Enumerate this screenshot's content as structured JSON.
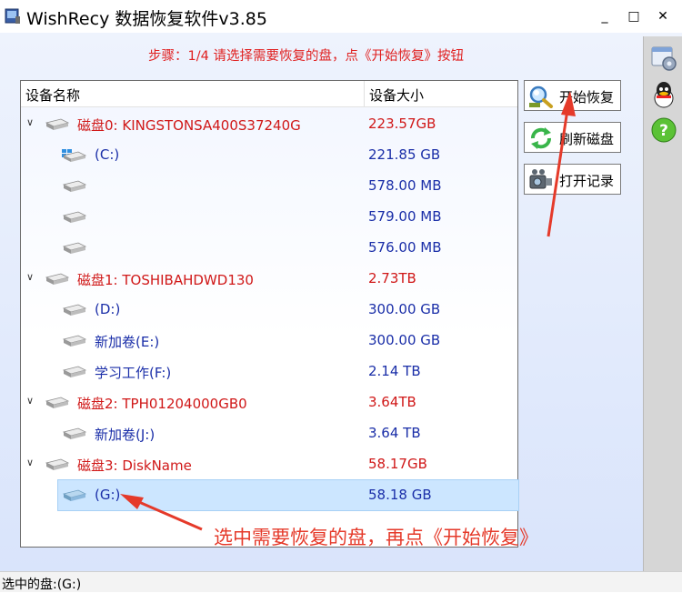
{
  "window": {
    "title": "WishRecy 数据恢复软件v3.85",
    "minimize_glyph": "_",
    "maximize_glyph": "□",
    "close_glyph": "✕"
  },
  "step_text": "步骤：1/4 请选择需要恢复的盘，点《开始恢复》按钮",
  "table": {
    "col_name": "设备名称",
    "col_size": "设备大小",
    "rows": [
      {
        "type": "disk",
        "icon": "hard-disk-icon",
        "label": "磁盘0: KINGSTONSA400S37240G",
        "size": "223.57GB"
      },
      {
        "type": "partition",
        "icon": "windows-drive-icon",
        "label": "(C:)",
        "size": "221.85 GB"
      },
      {
        "type": "partition",
        "icon": "drive-icon",
        "label": "",
        "size": "578.00 MB"
      },
      {
        "type": "partition",
        "icon": "drive-icon",
        "label": "",
        "size": "579.00 MB"
      },
      {
        "type": "partition",
        "icon": "drive-icon",
        "label": "",
        "size": "576.00 MB"
      },
      {
        "type": "disk",
        "icon": "hard-disk-icon",
        "label": "磁盘1: TOSHIBAHDWD130",
        "size": "2.73TB"
      },
      {
        "type": "partition",
        "icon": "drive-icon",
        "label": "(D:)",
        "size": "300.00 GB"
      },
      {
        "type": "partition",
        "icon": "drive-icon",
        "label": "新加卷(E:)",
        "size": "300.00 GB"
      },
      {
        "type": "partition",
        "icon": "drive-icon",
        "label": "学习工作(F:)",
        "size": "2.14 TB"
      },
      {
        "type": "disk",
        "icon": "hard-disk-icon",
        "label": "磁盘2: TPH01204000GB0",
        "size": "3.64TB"
      },
      {
        "type": "partition",
        "icon": "drive-icon",
        "label": "新加卷(J:)",
        "size": "3.64 TB"
      },
      {
        "type": "disk",
        "icon": "hard-disk-icon",
        "label": "磁盘3: DiskName",
        "size": "58.17GB"
      },
      {
        "type": "partition",
        "icon": "drive-icon",
        "label": "(G:)",
        "size": "58.18 GB",
        "selected": true
      }
    ]
  },
  "buttons": {
    "start": {
      "label": "开始恢复",
      "icon": "magnifier-icon"
    },
    "refresh": {
      "label": "刷新磁盘",
      "icon": "refresh-icon"
    },
    "log": {
      "label": "打开记录",
      "icon": "camera-icon"
    }
  },
  "side_icons": [
    "settings-icon",
    "qq-icon",
    "help-icon"
  ],
  "annotation": "选中需要恢复的盘，再点《开始恢复》",
  "status_text": "选中的盘:(G:)",
  "colors": {
    "disk_text": "#d01818",
    "partition_text": "#1a2ea8",
    "annotation": "#e53a2a",
    "selection": "#cce6ff"
  }
}
